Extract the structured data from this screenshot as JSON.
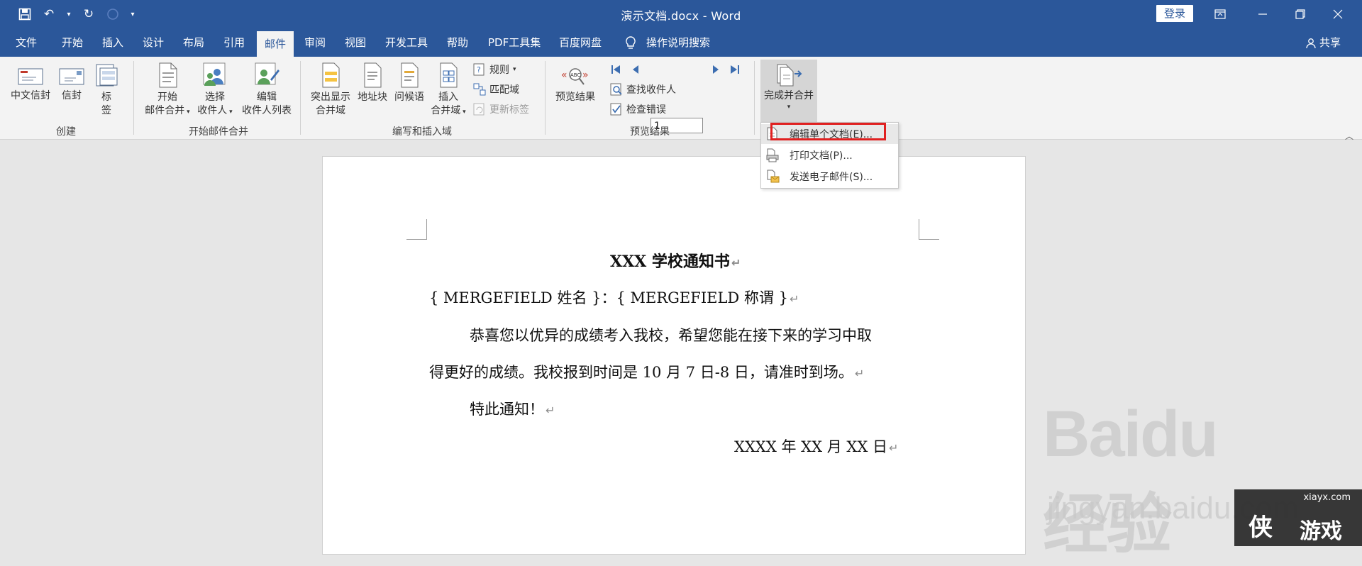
{
  "window": {
    "title": "演示文档.docx  -  Word",
    "login": "登录"
  },
  "menu": {
    "tabs": [
      "文件",
      "开始",
      "插入",
      "设计",
      "布局",
      "引用",
      "邮件",
      "审阅",
      "视图",
      "开发工具",
      "帮助",
      "PDF工具集",
      "百度网盘"
    ],
    "active_tab": "邮件",
    "tell_me": "操作说明搜索",
    "share": "共享"
  },
  "ribbon": {
    "chinese_envelope": "中文信封",
    "envelope": "信封",
    "labels_1": "标",
    "labels_2": "签",
    "group_create": "创建",
    "start_merge_1": "开始",
    "start_merge_2": "邮件合并",
    "select_recipients_1": "选择",
    "select_recipients_2": "收件人",
    "edit_list_1": "编辑",
    "edit_list_2": "收件人列表",
    "group_start": "开始邮件合并",
    "highlight_1": "突出显示",
    "highlight_2": "合并域",
    "address_block": "地址块",
    "greeting_line": "问候语",
    "insert_field_1": "插入",
    "insert_field_2": "合并域",
    "rules": "规则",
    "match_fields": "匹配域",
    "update_labels": "更新标签",
    "group_write": "编写和插入域",
    "preview_results": "预览结果",
    "record_number": "1",
    "find_recipient": "查找收件人",
    "check_errors": "检查错误",
    "group_preview": "预览结果",
    "finish_merge": "完成并合并"
  },
  "finish_menu": {
    "items": [
      "编辑单个文档(E)...",
      "打印文档(P)...",
      "发送电子邮件(S)..."
    ]
  },
  "document": {
    "title": "XXX 学校通知书",
    "merge_line": "{ MERGEFIELD 姓名 }：{ MERGEFIELD 称谓 }",
    "para1_line1": "恭喜您以优异的成绩考入我校，希望您能在接下来的学习中取",
    "para1_line2": "得更好的成绩。我校报到时间是 10 月 7 日-8 日，请准时到场。",
    "notice": "特此通知！",
    "date": "XXXX 年 XX 月 XX 日"
  },
  "watermark": {
    "logo": "Baidu经验",
    "url": "jingyan.baidu.com",
    "site": "xiayx.com",
    "brand_a": "侠",
    "brand_b": "游戏"
  },
  "icons": [
    "save-icon",
    "undo-icon",
    "redo-icon",
    "touch-mode-icon",
    "customize-qat-icon",
    "ribbon-display-icon",
    "minimize-icon",
    "restore-icon",
    "close-icon",
    "lightbulb-icon",
    "person-icon"
  ],
  "colors": {
    "word_blue": "#2b579a",
    "highlight_red": "#e02020",
    "ribbon_bg": "#f3f3f3"
  }
}
